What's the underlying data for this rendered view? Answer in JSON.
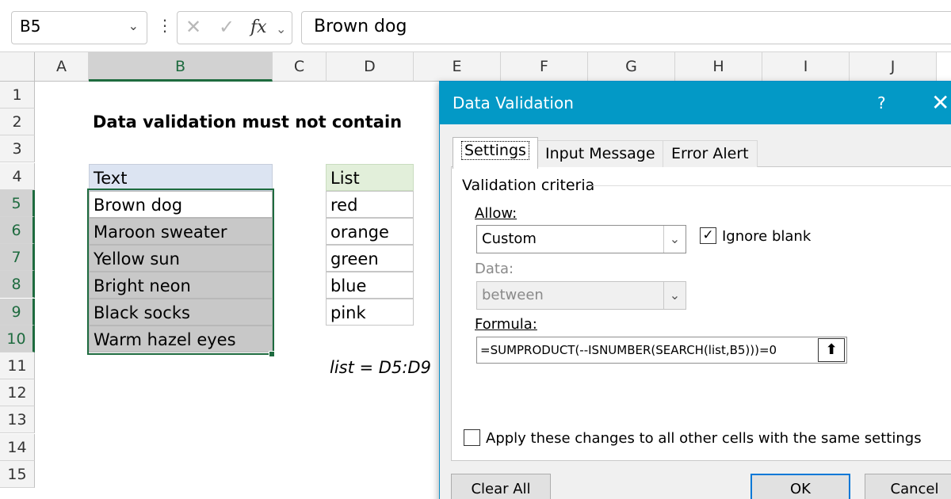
{
  "formula_bar": {
    "name_box": "B5",
    "name_box_icon": "chevron-down-icon",
    "more_icon": "vertical-dots-icon",
    "cancel_glyph": "✕",
    "enter_glyph": "✓",
    "fx_label": "fx",
    "value": "Brown dog"
  },
  "columns": [
    "A",
    "B",
    "C",
    "D",
    "E",
    "F",
    "G",
    "H",
    "I",
    "J"
  ],
  "rows": [
    "1",
    "2",
    "3",
    "4",
    "5",
    "6",
    "7",
    "8",
    "9",
    "10",
    "11",
    "12",
    "13",
    "14",
    "15"
  ],
  "selected_column": "B",
  "selected_rows": [
    "5",
    "6",
    "7",
    "8",
    "9",
    "10"
  ],
  "sheet": {
    "title": "Data validation must not contain",
    "text_table": {
      "header": "Text",
      "rows": [
        "Brown dog",
        "Maroon sweater",
        "Yellow sun",
        "Bright neon",
        "Black socks",
        "Warm hazel eyes"
      ]
    },
    "list_table": {
      "header": "List",
      "rows": [
        "red",
        "orange",
        "green",
        "blue",
        "pink"
      ]
    },
    "note": "list = D5:D9"
  },
  "dialog": {
    "title": "Data Validation",
    "help_glyph": "?",
    "close_glyph": "✕",
    "tabs": [
      "Settings",
      "Input Message",
      "Error Alert"
    ],
    "active_tab": "Settings",
    "group_label": "Validation criteria",
    "allow_label": "Allow:",
    "allow_value": "Custom",
    "ignore_blank_label": "Ignore blank",
    "ignore_blank_checked": true,
    "data_label": "Data:",
    "data_value": "between",
    "formula_label": "Formula:",
    "formula_value": "=SUMPRODUCT(--ISNUMBER(SEARCH(list,B5)))=0",
    "apply_all_label": "Apply these changes to all other cells with the same settings",
    "apply_all_checked": false,
    "buttons": {
      "clear_all": "Clear All",
      "ok": "OK",
      "cancel": "Cancel"
    }
  },
  "colors": {
    "selection_green": "#1e6b3f",
    "text_header_fill": "#dce4f2",
    "list_header_fill": "#e2efda",
    "dialog_title_bar": "#0399c6"
  }
}
